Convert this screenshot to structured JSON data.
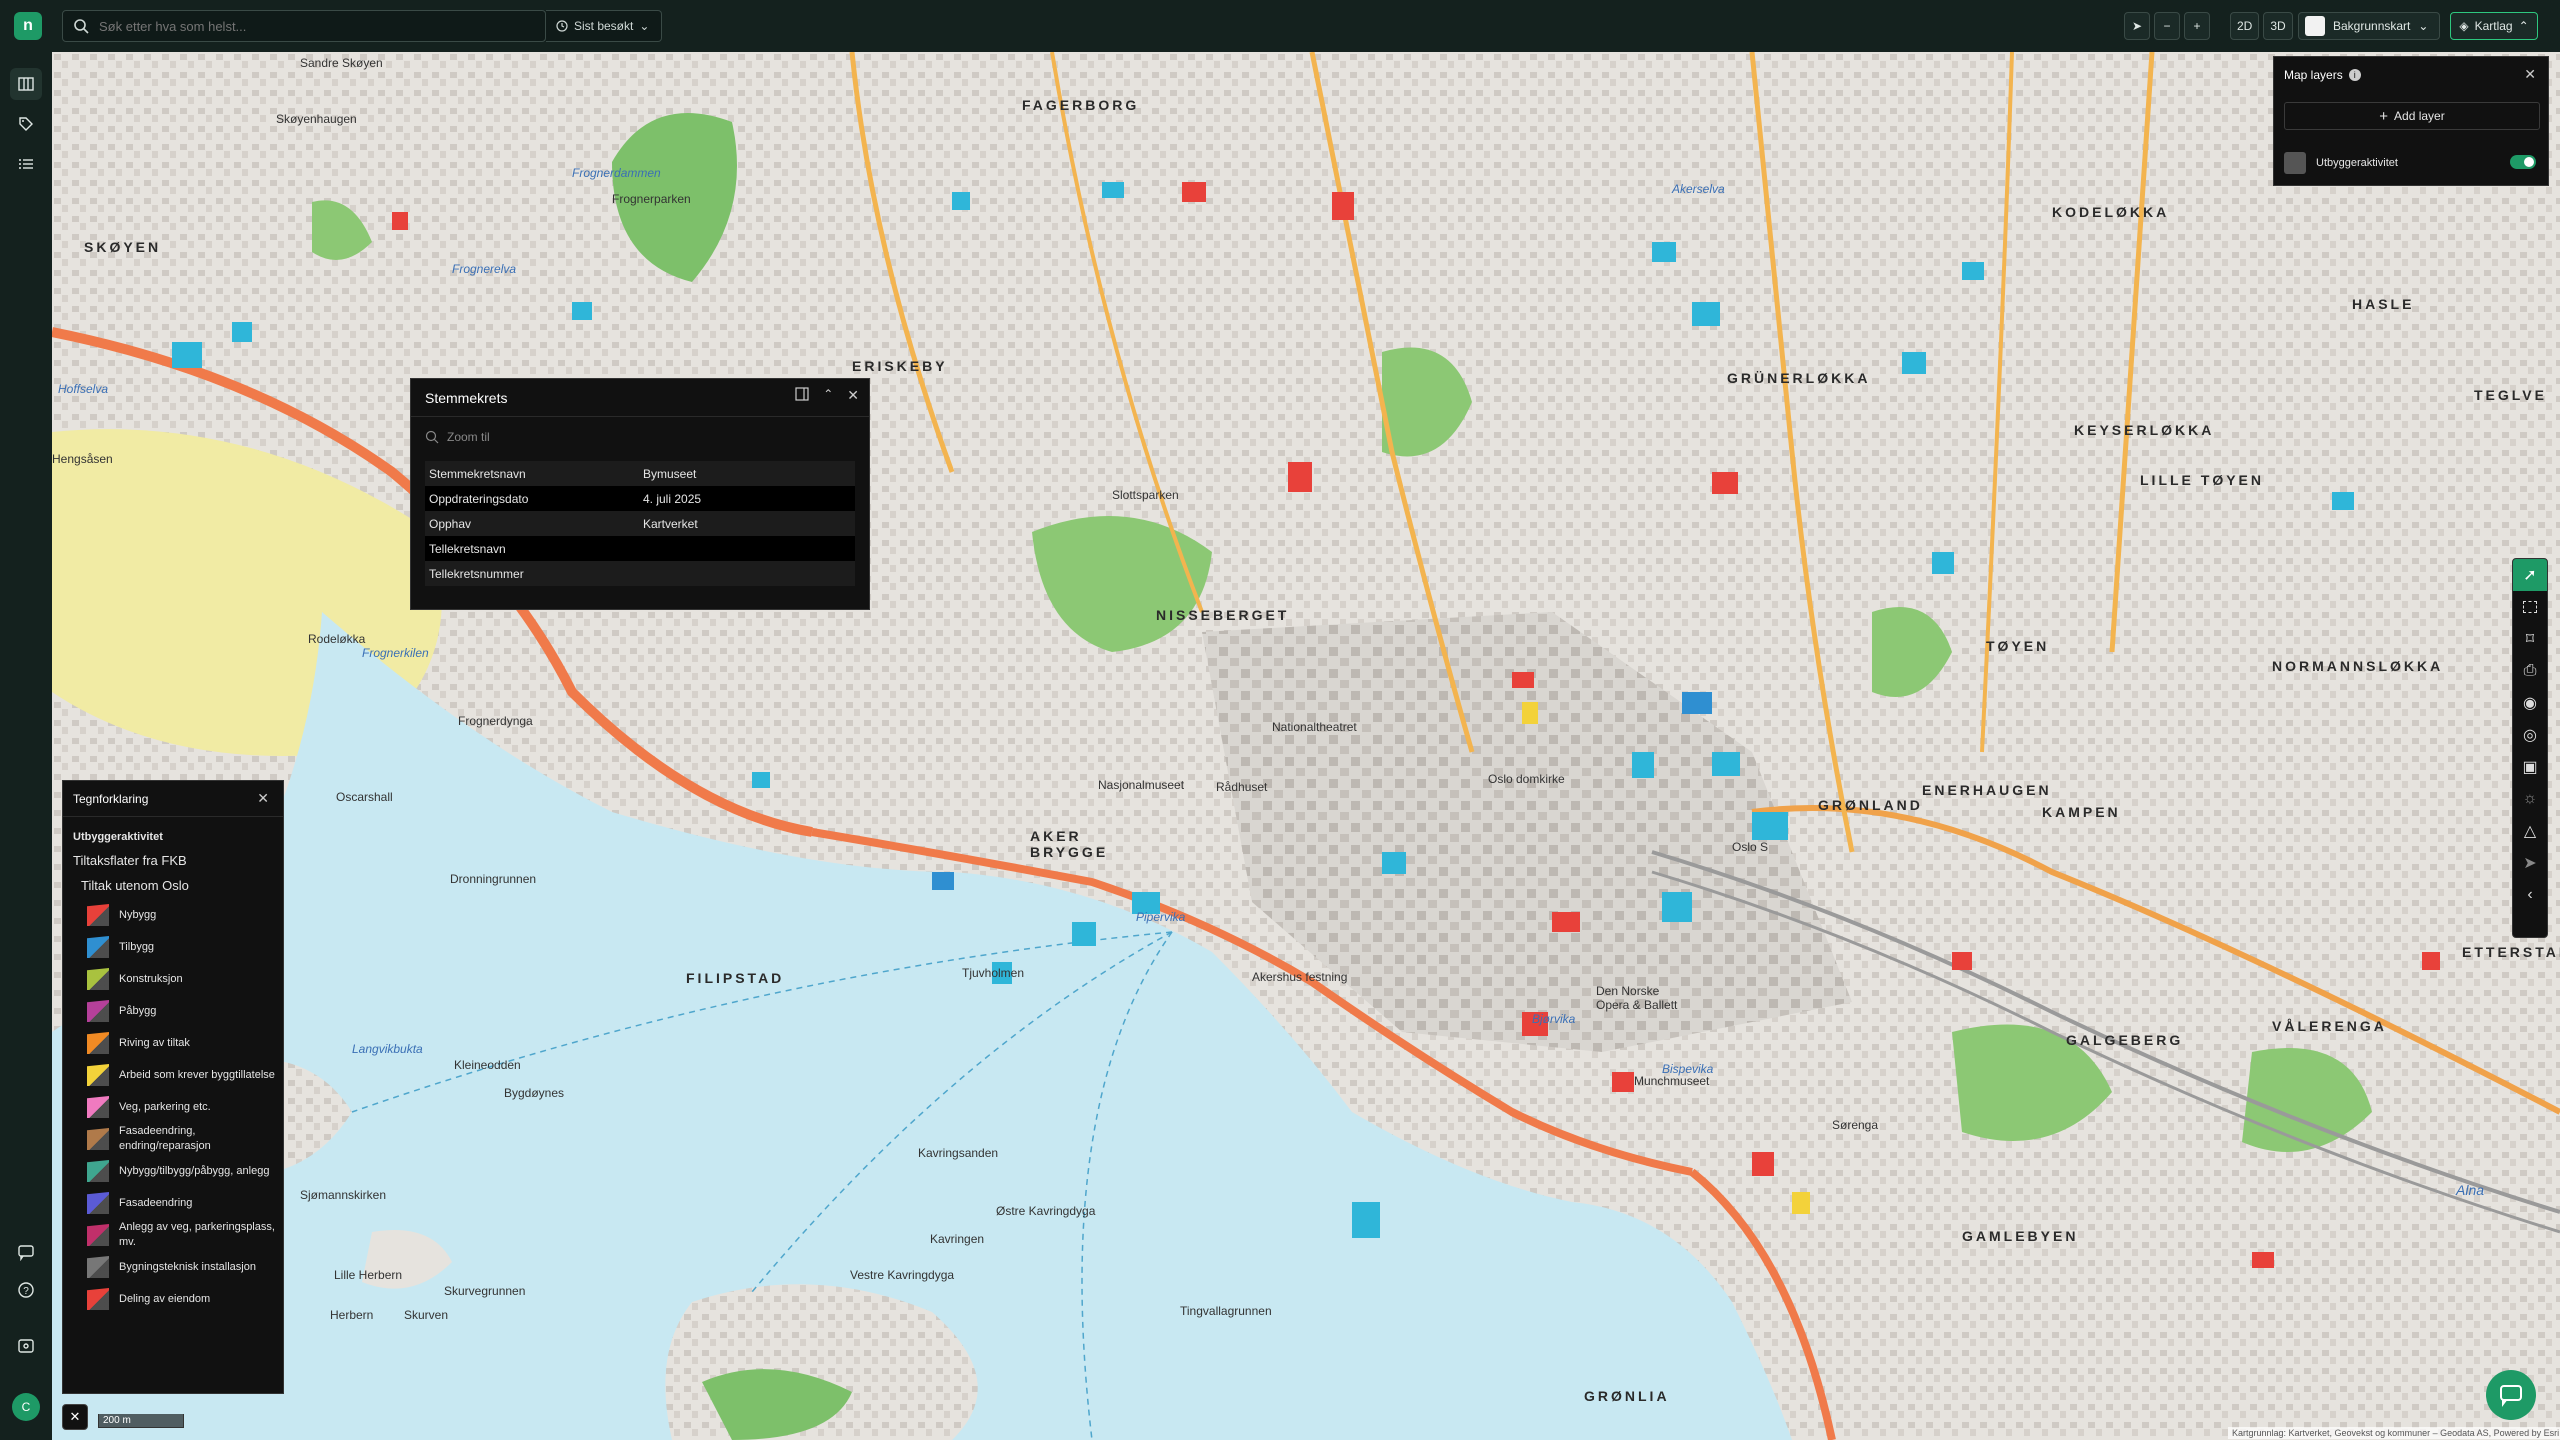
{
  "topbar": {
    "search_placeholder": "Søk etter hva som helst...",
    "recent_label": "Sist besøkt",
    "mode_2d": "2D",
    "mode_3d": "3D",
    "background_map_label": "Bakgrunnskart",
    "map_layers_button": "Kartlag",
    "zoom_out": "−",
    "zoom_in": "+"
  },
  "rail": {
    "avatar_initial": "C"
  },
  "popup": {
    "title": "Stemmekrets",
    "zoom_to": "Zoom til",
    "rows": [
      {
        "key": "Stemmekretsnavn",
        "value": "Bymuseet"
      },
      {
        "key": "Oppdrateringsdato",
        "value": "4. juli 2025"
      },
      {
        "key": "Opphav",
        "value": "Kartverket"
      },
      {
        "key": "Tellekretsnavn",
        "value": ""
      },
      {
        "key": "Tellekretsnummer",
        "value": ""
      }
    ]
  },
  "legend": {
    "title": "Tegnforklaring",
    "section": "Utbyggeraktivitet",
    "group1": "Tiltaksflater fra FKB",
    "group2": "Tiltak utenom Oslo",
    "items": [
      {
        "label": "Nybygg",
        "color": "#e8413a"
      },
      {
        "label": "Tilbygg",
        "color": "#2f8fd1"
      },
      {
        "label": "Konstruksjon",
        "color": "#a9c23f"
      },
      {
        "label": "Påbygg",
        "color": "#b5409a"
      },
      {
        "label": "Riving av tiltak",
        "color": "#f08a24"
      },
      {
        "label": "Arbeid som krever byggtillatelse",
        "color": "#f3d23a"
      },
      {
        "label": "Veg, parkering etc.",
        "color": "#f07ac0"
      },
      {
        "label": "Fasadeendring, endring/reparasjon",
        "color": "#b07a4a"
      },
      {
        "label": "Nybygg/tilbygg/påbygg, anlegg",
        "color": "#3fa68f"
      },
      {
        "label": "Fasadeendring",
        "color": "#5b5bd6"
      },
      {
        "label": "Anlegg av veg, parkeringsplass, mv.",
        "color": "#c0306a"
      },
      {
        "label": "Bygningsteknisk installasjon",
        "color": "#777777"
      },
      {
        "label": "Deling av eiendom",
        "color": "#e8413a"
      }
    ]
  },
  "layers": {
    "title": "Map layers",
    "add_layer": "Add layer",
    "layer_name": "Utbyggeraktivitet"
  },
  "map": {
    "labels": [
      {
        "t": "FAGERBORG"
      },
      {
        "t": "KODELØKKA"
      },
      {
        "t": "SKØYEN"
      },
      {
        "t": "HASLE"
      },
      {
        "t": "GRÜNERLØKKA"
      },
      {
        "t": "KEYSERLØKKA"
      },
      {
        "t": "TEGLVE"
      },
      {
        "t": "LILLE TØYEN"
      },
      {
        "t": "NISSEBERGET"
      },
      {
        "t": "TØYEN"
      },
      {
        "t": "NORMANNSLØKKA"
      },
      {
        "t": "GRØNLAND"
      },
      {
        "t": "ENERHAUGEN"
      },
      {
        "t": "KAMPEN"
      },
      {
        "t": "AKER BRYGGE"
      },
      {
        "t": "FILIPSTAD"
      },
      {
        "t": "GALGEBERG"
      },
      {
        "t": "VÅLERENGA"
      },
      {
        "t": "ETTERSTAD"
      },
      {
        "t": "GAMLEBYEN"
      },
      {
        "t": "GRØNLIA"
      },
      {
        "t": "Hengsåsen"
      },
      {
        "t": "Frognerparken"
      },
      {
        "t": "Frognerelva"
      },
      {
        "t": "Akerselva"
      },
      {
        "t": "Frognerkilen"
      },
      {
        "t": "Pipervika"
      },
      {
        "t": "Bjørvika"
      },
      {
        "t": "Bispevika"
      },
      {
        "t": "Langvikbukta"
      },
      {
        "t": "Oscarshall"
      },
      {
        "t": "Kavringen"
      },
      {
        "t": "Østre Kavringdyga"
      },
      {
        "t": "Vestre Kavringdyga"
      },
      {
        "t": "Kavringsanden"
      },
      {
        "t": "Tingvallagrunnen"
      },
      {
        "t": "Lille Herbern"
      },
      {
        "t": "Herbern"
      },
      {
        "t": "Skurven"
      },
      {
        "t": "Skurvegrunnen"
      },
      {
        "t": "Kleineodden"
      },
      {
        "t": "Bygdøynes"
      },
      {
        "t": "Dronningrunnen"
      },
      {
        "t": "Frognerdynga"
      },
      {
        "t": "Rodeløkka"
      },
      {
        "t": "Sjømannskirken"
      },
      {
        "t": "Akershus festning"
      },
      {
        "t": "Den Norske Opera & Ballett"
      },
      {
        "t": "Munchmuseet"
      },
      {
        "t": "Slottsparken"
      },
      {
        "t": "Nationaltheatret"
      },
      {
        "t": "Rådhuset"
      },
      {
        "t": "Oslo domkirke"
      },
      {
        "t": "Sørenga"
      },
      {
        "t": "Alna"
      },
      {
        "t": "Sandre Skøyen"
      },
      {
        "t": "Skøyenhaugen"
      },
      {
        "t": "Frognerdammen"
      },
      {
        "t": "ERISKEBY"
      },
      {
        "t": "Oslo S"
      },
      {
        "t": "Tjuvholmen"
      },
      {
        "t": "Nasjonalmuseet"
      },
      {
        "t": "Hoffselva"
      }
    ],
    "scale_label": "200 m",
    "attribution": "Kartgrunnlag: Kartverket, Geovekst og kommuner – Geodata AS, Powered by Esri"
  }
}
